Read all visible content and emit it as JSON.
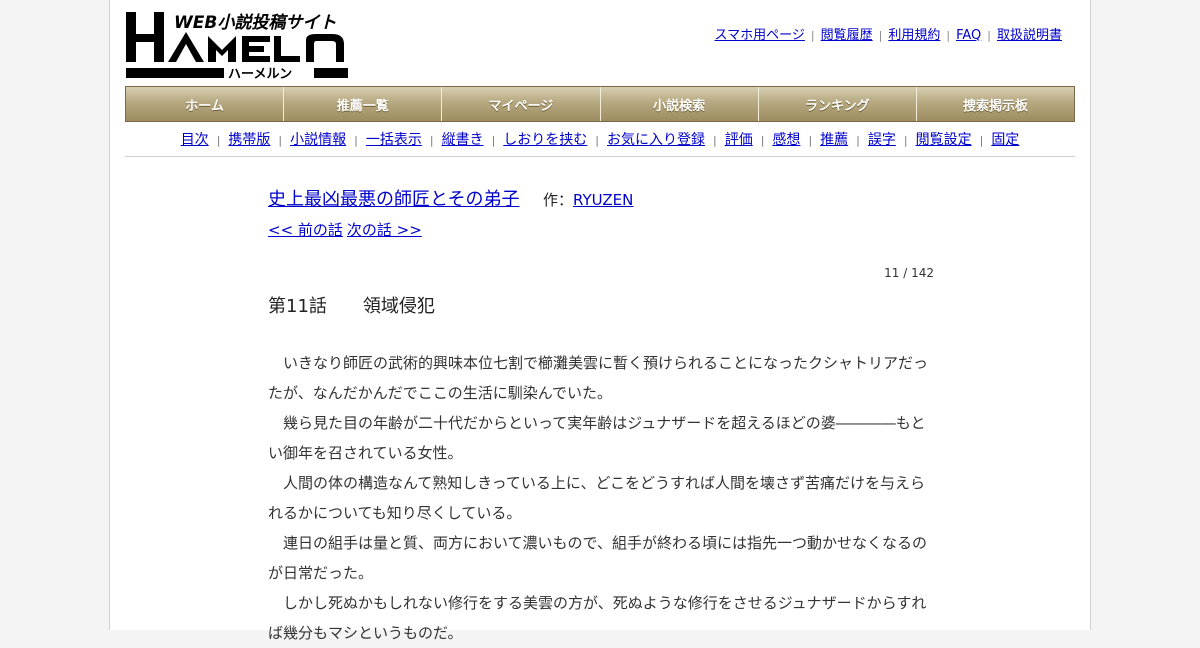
{
  "site": {
    "logo_main": "HAMELN",
    "logo_sub": "WEB小説投稿サイト",
    "logo_kana": "ハーメルン"
  },
  "top_links": [
    {
      "label": "スマホ用ページ"
    },
    {
      "label": "閲覧履歴"
    },
    {
      "label": "利用規約"
    },
    {
      "label": "FAQ"
    },
    {
      "label": "取扱説明書"
    }
  ],
  "nav": [
    {
      "label": "ホーム"
    },
    {
      "label": "推薦一覧"
    },
    {
      "label": "マイページ"
    },
    {
      "label": "小説検索"
    },
    {
      "label": "ランキング"
    },
    {
      "label": "捜索掲示板"
    }
  ],
  "sub_nav": [
    {
      "label": "目次"
    },
    {
      "label": "携帯版"
    },
    {
      "label": "小説情報"
    },
    {
      "label": "一括表示"
    },
    {
      "label": "縦書き"
    },
    {
      "label": "しおりを挟む"
    },
    {
      "label": "お気に入り登録"
    },
    {
      "label": "評価"
    },
    {
      "label": "感想"
    },
    {
      "label": "推薦"
    },
    {
      "label": "誤字"
    },
    {
      "label": "閲覧設定"
    },
    {
      "label": "固定"
    }
  ],
  "novel": {
    "title": "史上最凶最悪の師匠とその弟子",
    "author_prefix": "作：",
    "author": "RYUZEN",
    "prev": "<< 前の話",
    "next": "次の話 >>",
    "counter": "11 / 142",
    "chapter_title": "第11話　　領域侵犯",
    "paragraphs": [
      "いきなり師匠の武術的興味本位七割で櫛灘美雲に暫く預けられることになったクシャトリアだったが、なんだかんだでここの生活に馴染んでいた。",
      "幾ら見た目の年齢が二十代だからといって実年齢はジュナザードを超えるほどの婆――――もとい御年を召されている女性。",
      "人間の体の構造なんて熟知しきっている上に、どこをどうすれば人間を壊さず苦痛だけを与えられるかについても知り尽くしている。",
      "連日の組手は量と質、両方において濃いもので、組手が終わる頃には指先一つ動かせなくなるのが日常だった。",
      "しかし死ぬかもしれない修行をする美雲の方が、死ぬような修行をさせるジュナザードからすれば幾分もマシというものだ。"
    ]
  },
  "colors": {
    "link": "#0000cc",
    "nav_gradient_top": "#d7ceb2",
    "nav_gradient_bottom": "#9c8c60"
  }
}
